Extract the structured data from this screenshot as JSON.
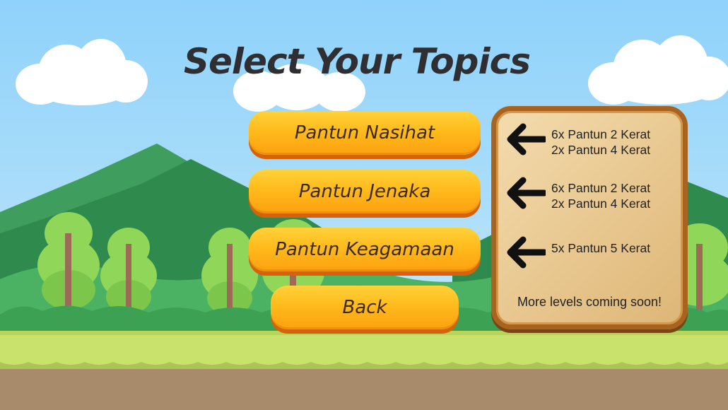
{
  "screen": {
    "title": "Select Your Topics"
  },
  "menu": {
    "nasihat_label": "Pantun Nasihat",
    "jenaka_label": "Pantun Jenaka",
    "keagamaan_label": "Pantun Keagamaan",
    "back_label": "Back"
  },
  "info": {
    "nasihat_line1": "6x Pantun 2 Kerat",
    "nasihat_line2": "2x Pantun 4 Kerat",
    "jenaka_line1": "6x Pantun 2 Kerat",
    "jenaka_line2": "2x Pantun 4 Kerat",
    "keagamaan_line1": "5x Pantun 5 Kerat",
    "coming_soon": "More levels coming soon!"
  },
  "icons": {
    "arrow": "arrow-left-icon",
    "cloud": "cloud-icon",
    "tree": "tree-icon"
  },
  "colors": {
    "button_top": "#ffd23a",
    "button_bottom": "#fca00f",
    "panel_border": "#a8641f",
    "title_text": "#2f2f33"
  }
}
